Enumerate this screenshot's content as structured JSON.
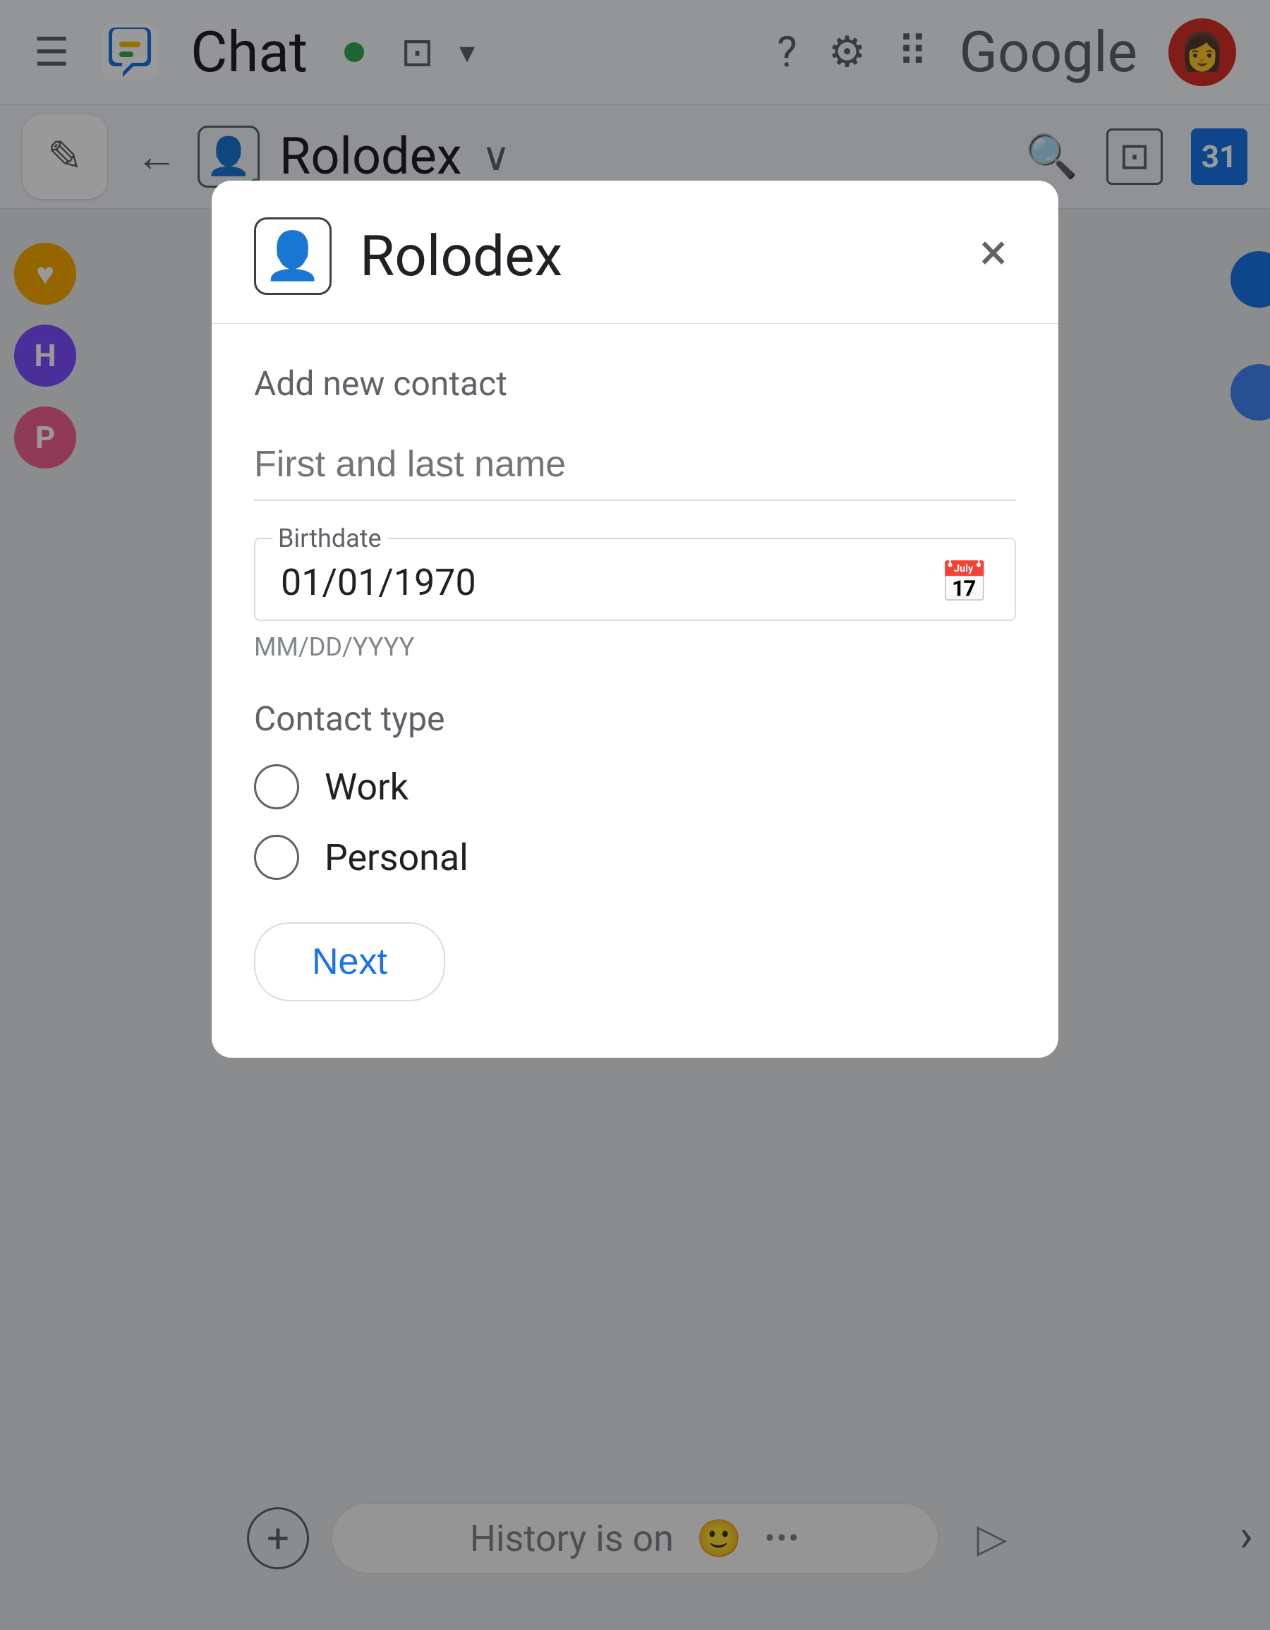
{
  "topBar": {
    "hamburger": "☰",
    "chatTitle": "Chat",
    "status": "online",
    "statusColor": "#34a853",
    "icons": {
      "help": "?",
      "settings": "⚙",
      "apps": "⠿",
      "google": "Google"
    }
  },
  "subBar": {
    "backArrow": "←",
    "rolodexName": "Rolodex",
    "chevron": "∨",
    "calendar31": "31"
  },
  "modal": {
    "title": "Rolodex",
    "closeLabel": "×",
    "sectionLabel": "Add new contact",
    "nameFieldPlaceholder": "First and last name",
    "birthdateLabel": "Birthdate",
    "birthdateValue": "01/01/1970",
    "formatHint": "MM/DD/YYYY",
    "calendarIcon": "📅",
    "contactTypeLabel": "Contact type",
    "options": [
      {
        "label": "Work",
        "selected": false
      },
      {
        "label": "Personal",
        "selected": false
      }
    ],
    "nextButton": "Next"
  },
  "bottomBar": {
    "addIcon": "+",
    "historyText": "History is on",
    "emojiIcon": "🙂",
    "moreIcon": "•••",
    "sendIcon": "▷"
  },
  "sidebar": {
    "badges": [
      {
        "color": "#f9ab00",
        "letter": ""
      },
      {
        "color": "#7c4dff",
        "letter": "H"
      },
      {
        "color": "#f06292",
        "letter": "P"
      }
    ]
  }
}
